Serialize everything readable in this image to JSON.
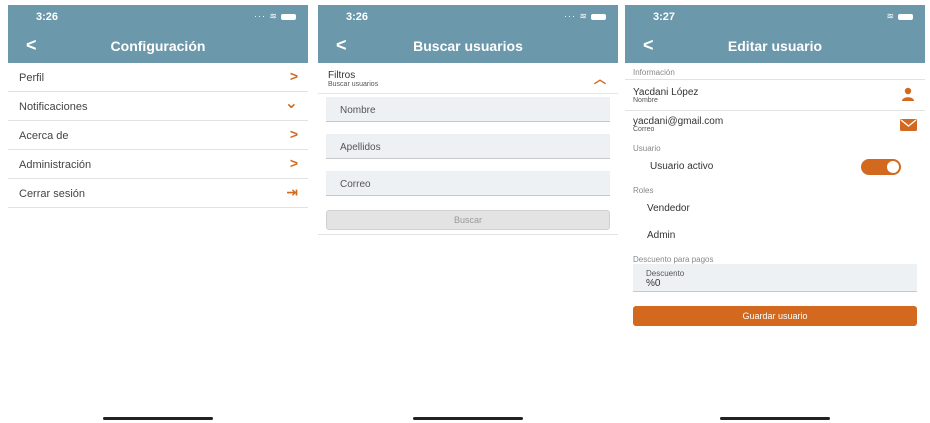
{
  "screens": [
    {
      "status_time": "3:26",
      "nav_title": "Configuración",
      "menu": [
        {
          "label": "Perfil",
          "icon": "chevron-right-icon",
          "glyph": ">"
        },
        {
          "label": "Notificaciones",
          "icon": "chevron-down-icon",
          "glyph": "⌄"
        },
        {
          "label": "Acerca de",
          "icon": "chevron-right-icon",
          "glyph": ">"
        },
        {
          "label": "Administración",
          "icon": "chevron-right-icon",
          "glyph": ">"
        },
        {
          "label": "Cerrar sesión",
          "icon": "logout-icon",
          "glyph": "⇥"
        }
      ]
    },
    {
      "status_time": "3:26",
      "nav_title": "Buscar usuarios",
      "filters_title": "Filtros",
      "filters_subtitle": "Buscar usuarios",
      "fields": [
        "Nombre",
        "Apellidos",
        "Correo"
      ],
      "search_button": "Buscar"
    },
    {
      "status_time": "3:27",
      "nav_title": "Editar usuario",
      "section_info": "Información",
      "name_value": "Yacdani López",
      "name_label": "Nombre",
      "email_value": "yacdani@gmail.com",
      "email_label": "Correo",
      "section_user": "Usuario",
      "active_label": "Usuario activo",
      "active_on": true,
      "section_roles": "Roles",
      "roles": [
        "Vendedor",
        "Admin"
      ],
      "section_discount": "Descuento para pagos",
      "discount_label": "Descuento",
      "discount_value": "%0",
      "save_button": "Guardar usuario"
    }
  ],
  "colors": {
    "header": "#6b98aa",
    "accent": "#d2691e"
  }
}
